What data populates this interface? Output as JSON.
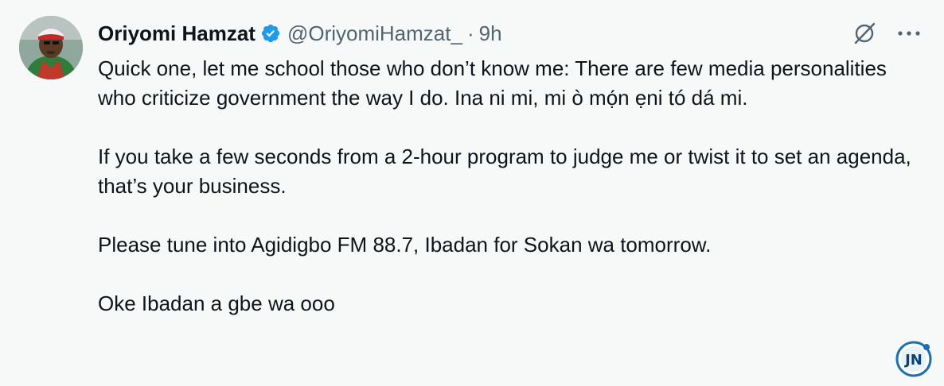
{
  "tweet": {
    "display_name": "Oriyomi Hamzat",
    "handle": "@OriyomiHamzat_",
    "separator": "·",
    "time": "9h",
    "paragraphs": [
      "Quick one, let me school those who don’t know me: There are few media personalities who criticize government the way I do. Ina ni mi, mi ò mọ́n ẹni tó dá mi.",
      "If you take a few seconds from a 2-hour program to judge me or twist it to set an agenda, that’s your business.",
      "Please tune into Agidigbo FM 88.7, Ibadan for Sokan wa tomorrow.",
      "Oke Ibadan a gbe wa ooo"
    ]
  },
  "icons": {
    "verified": "verified-badge-icon",
    "grok": "grok-icon",
    "more": "more-options-icon",
    "watermark": "jn-logo"
  },
  "watermark": {
    "text": "JN"
  },
  "colors": {
    "background": "#f7f9f9",
    "text": "#0f1419",
    "secondary_text": "#536471",
    "verified_blue": "#1d9bf0"
  }
}
